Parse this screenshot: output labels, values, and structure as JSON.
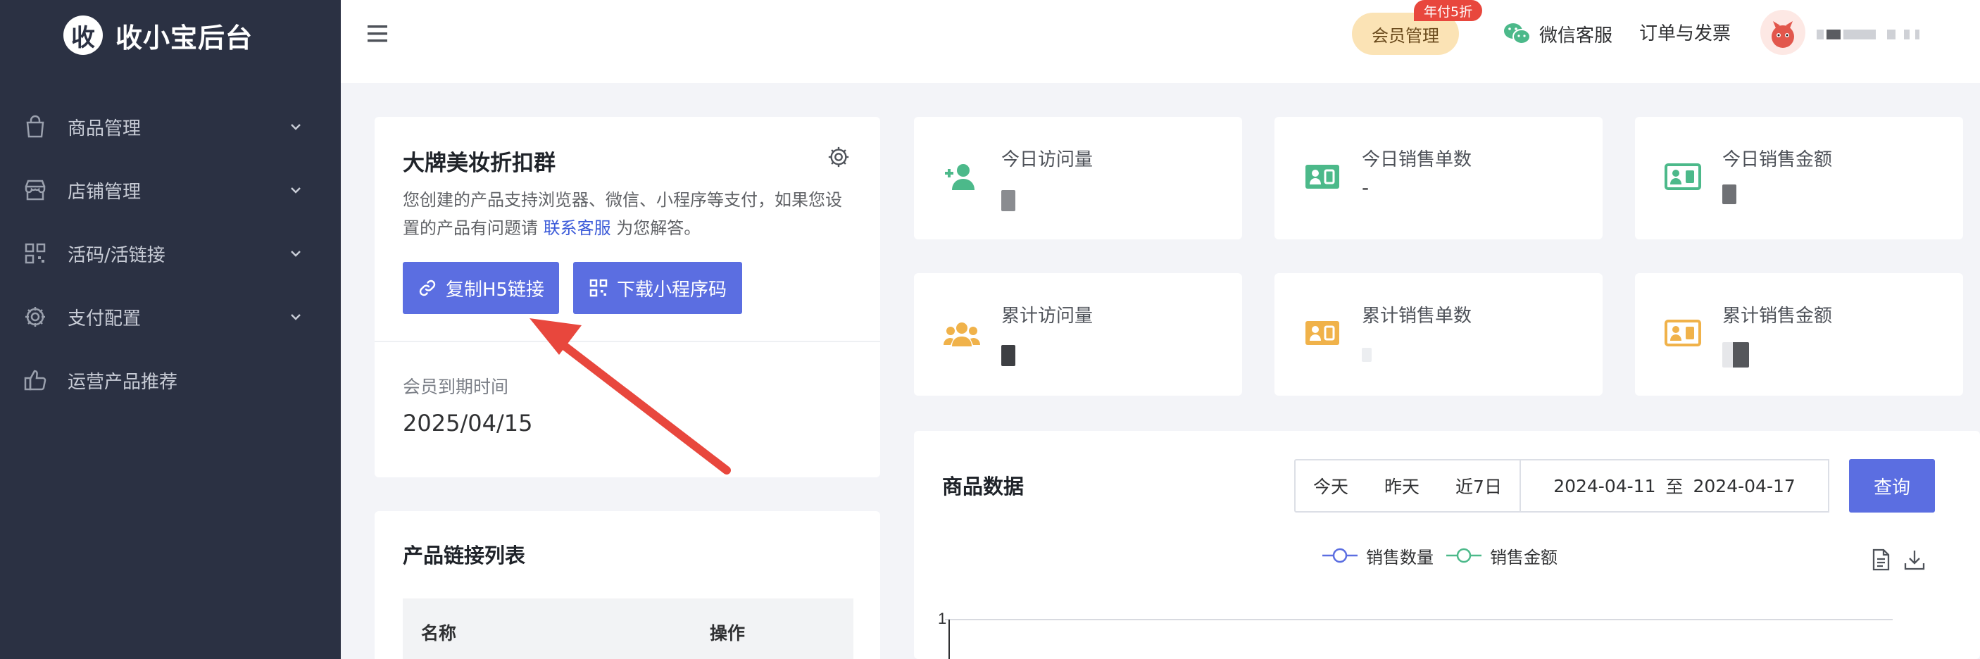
{
  "app": {
    "logo_char": "收",
    "title": "收小宝后台"
  },
  "sidebar": {
    "items": [
      {
        "label": "商品管理",
        "icon": "bag-icon"
      },
      {
        "label": "店铺管理",
        "icon": "store-icon"
      },
      {
        "label": "活码/活链接",
        "icon": "qrcode-icon"
      },
      {
        "label": "支付配置",
        "icon": "gear-icon"
      },
      {
        "label": "运营产品推荐",
        "icon": "thumbs-up-icon"
      }
    ]
  },
  "header": {
    "member_label": "会员管理",
    "promo_badge": "年付5折",
    "wechat_label": "微信客服",
    "orders_label": "订单与发票"
  },
  "shop": {
    "title": "大牌美妆折扣群",
    "desc_before": "您创建的产品支持浏览器、微信、小程序等支付，如果您设置的产品有问题请 ",
    "desc_link": "联系客服",
    "desc_after": " 为您解答。",
    "copy_btn": "复制H5链接",
    "download_btn": "下载小程序码",
    "expire_label": "会员到期时间",
    "expire_value": "2025/04/15"
  },
  "product_list": {
    "title": "产品链接列表",
    "columns": [
      "名称",
      "操作"
    ]
  },
  "stats": [
    {
      "label": "今日访问量",
      "value": "",
      "icon": "user-add-icon"
    },
    {
      "label": "今日销售单数",
      "value": "-",
      "icon": "money-icon"
    },
    {
      "label": "今日销售金额",
      "value": "",
      "icon": "money-icon"
    },
    {
      "label": "累计访问量",
      "value": "",
      "icon": "users-icon"
    },
    {
      "label": "累计销售单数",
      "value": "",
      "icon": "money-icon"
    },
    {
      "label": "累计销售金额",
      "value": "",
      "icon": "money-icon"
    }
  ],
  "goods_data": {
    "title": "商品数据",
    "filters": [
      "今天",
      "昨天",
      "近7日"
    ],
    "date_start": "2024-04-11",
    "date_sep": "至",
    "date_end": "2024-04-17",
    "query_btn": "查询",
    "legend": [
      "销售数量",
      "销售金额"
    ],
    "y_tick": "1"
  },
  "colors": {
    "accent": "#5b6ee1",
    "green": "#4cb98a",
    "orange": "#f0b24a",
    "sidebar": "#2b3143",
    "arrow": "#e8473d"
  }
}
